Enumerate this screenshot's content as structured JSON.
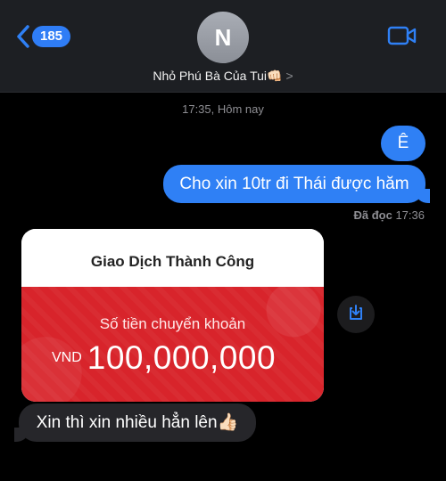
{
  "header": {
    "back_count": "185",
    "avatar_initial": "N",
    "contact_name": "Nhỏ Phú Bà Của Tui👊🏻",
    "chevron": ">"
  },
  "thread": {
    "timestamp": "17:35, Hôm nay",
    "sent": [
      {
        "text": "Ê"
      },
      {
        "text": "Cho xin 10tr đi Thái được hăm"
      }
    ],
    "read_status": "Đã đọc",
    "read_time": "17:36",
    "transfer_card": {
      "title": "Giao Dịch Thành Công",
      "label": "Số tiền chuyển khoản",
      "currency": "VND",
      "amount": "100,000,000"
    },
    "received": [
      {
        "text": "Xin thì xin nhiều hẳn lên👍🏻"
      }
    ]
  },
  "icons": {
    "back": "chevron-left-icon",
    "video": "video-camera-icon",
    "download": "download-icon"
  },
  "colors": {
    "accent": "#2f80f5",
    "incoming_bubble": "#26262a",
    "card_red": "#d8242b"
  }
}
